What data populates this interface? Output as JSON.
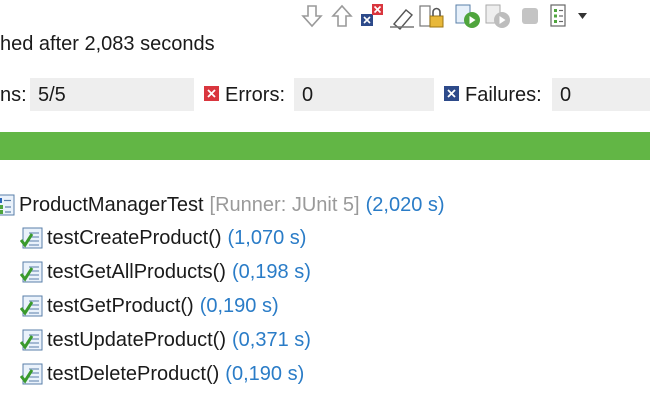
{
  "toolbar": {
    "icons": [
      "next-failure-icon",
      "previous-failure-icon",
      "show-failures-only-icon",
      "clear-icon",
      "scroll-lock-icon",
      "rerun-test-icon",
      "rerun-failed-first-icon",
      "stop-icon",
      "test-run-history-icon",
      "view-menu-icon"
    ]
  },
  "status": {
    "text": "hed after 2,083 seconds"
  },
  "counters": {
    "runs_label": "ns:",
    "runs_value": "5/5",
    "errors_label": "Errors:",
    "errors_value": "0",
    "failures_label": "Failures:",
    "failures_value": "0"
  },
  "progress": {
    "fraction": 1.0,
    "color": "#62b645"
  },
  "tree": {
    "suite": {
      "name": "ProductManagerTest",
      "runner": "[Runner: JUnit 5]",
      "time": "(2,020 s)"
    },
    "tests": [
      {
        "name": "testCreateProduct()",
        "time": "(1,070 s)"
      },
      {
        "name": "testGetAllProducts()",
        "time": "(0,198 s)"
      },
      {
        "name": "testGetProduct()",
        "time": "(0,190 s)"
      },
      {
        "name": "testUpdateProduct()",
        "time": "(0,371 s)"
      },
      {
        "name": "testDeleteProduct()",
        "time": "(0,190 s)"
      }
    ]
  },
  "colors": {
    "accent_blue": "#2a7cc7",
    "runner_gray": "#9a9a9a",
    "success_green": "#62b645",
    "error_red": "#d9363e",
    "failure_navy": "#2d4a8a"
  }
}
